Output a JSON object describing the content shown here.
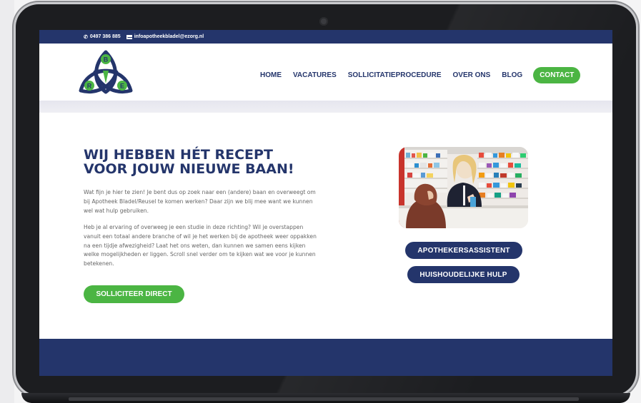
{
  "topbar": {
    "phone": "0497 386 885",
    "phone_icon": "phone-icon",
    "email": "infoapotheekbladel@ezorg.nl",
    "email_icon": "envelope-icon"
  },
  "logo": {
    "letters": [
      "B",
      "R",
      "E"
    ],
    "colors": {
      "outline": "#24356b",
      "fill": "#4bb543"
    }
  },
  "nav": {
    "items": [
      "HOME",
      "VACATURES",
      "SOLLICITATIEPROCEDURE",
      "OVER ONS",
      "BLOG"
    ],
    "contact": "CONTACT"
  },
  "hero": {
    "title_line1": "WIJ HEBBEN HÉT RECEPT",
    "title_line2": "VOOR JOUW NIEUWE BAAN!",
    "paragraph1": "Wat fijn je hier te zien! Je bent dus op zoek naar een (andere) baan en overweegt om bij Apotheek Bladel/Reusel te komen werken? Daar zijn we blij mee want we kunnen wel wat hulp gebruiken.",
    "paragraph2": "Heb je al ervaring of overweeg je een studie in deze richting? Wil je overstappen vanuit een totaal andere branche of wil je het werken bij de apotheek weer oppakken na een tijdje afwezigheid? Laat het ons weten, dan kunnen we samen eens kijken welke mogelijkheden er liggen. Scroll snel verder om te kijken wat we voor je kunnen betekenen.",
    "cta": "SOLLICITEER DIRECT"
  },
  "jobs": [
    "APOTHEKERSASSISTENT",
    "HUISHOUDELIJKE HULP"
  ],
  "colors": {
    "navy": "#24356b",
    "green": "#4bb543",
    "text_gray": "#666666"
  }
}
